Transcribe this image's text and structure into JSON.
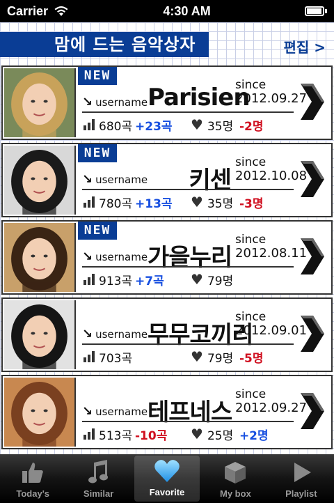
{
  "status_bar": {
    "carrier": "Carrier",
    "time": "4:30 AM",
    "battery_level": 0.95
  },
  "header": {
    "title": "맘에 드는 음악상자",
    "edit_label": "편집 >"
  },
  "cards": [
    {
      "badge": "NEW",
      "username": "username",
      "name": "Parisien",
      "since_label": "since",
      "since_date": "2012.09.27",
      "songs": "680곡",
      "songs_delta": "+23곡",
      "likes": "35명",
      "likes_delta": "-2명",
      "avatar_hair": "#c8a25a",
      "avatar_bg": "#7a8a5a"
    },
    {
      "badge": "NEW",
      "username": "username",
      "name": "키센",
      "since_label": "since",
      "since_date": "2012.10.08",
      "songs": "780곡",
      "songs_delta": "+13곡",
      "likes": "35명",
      "likes_delta": "-3명",
      "avatar_hair": "#1a1a1a",
      "avatar_bg": "#d8d8d8"
    },
    {
      "badge": "NEW",
      "username": "username",
      "name": "가을누리",
      "since_label": "since",
      "since_date": "2012.08.11",
      "songs": "913곡",
      "songs_delta": "+7곡",
      "likes": "79명",
      "likes_delta": "",
      "avatar_hair": "#3a2414",
      "avatar_bg": "#c8a06a"
    },
    {
      "badge": "",
      "username": "username",
      "name": "무무코끼리",
      "since_label": "since",
      "since_date": "2012.09.01",
      "songs": "703곡",
      "songs_delta": "",
      "likes": "79명",
      "likes_delta": "-5명",
      "avatar_hair": "#151515",
      "avatar_bg": "#e2e2e2"
    },
    {
      "badge": "",
      "username": "username",
      "name": "테프네스",
      "since_label": "since",
      "since_date": "2012.09.27",
      "songs": "513곡",
      "songs_delta": "-10곡",
      "likes": "25명",
      "likes_delta": "+2명",
      "avatar_hair": "#7a4020",
      "avatar_bg": "#c88850"
    }
  ],
  "tabs": [
    {
      "label": "Today's",
      "icon": "thumbs-up-icon"
    },
    {
      "label": "Similar",
      "icon": "music-note-icon"
    },
    {
      "label": "Favorite",
      "icon": "heart-icon",
      "active": true
    },
    {
      "label": "My box",
      "icon": "box-icon"
    },
    {
      "label": "Playlist",
      "icon": "play-icon"
    }
  ],
  "colors": {
    "brand_blue": "#0a3d95",
    "positive": "#1850e0",
    "negative": "#d01020"
  }
}
